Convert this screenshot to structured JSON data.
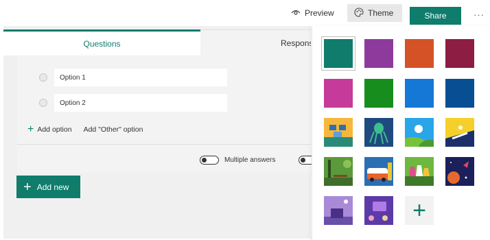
{
  "topbar": {
    "preview_label": "Preview",
    "theme_label": "Theme",
    "share_label": "Share",
    "more_label": "···"
  },
  "tabs": {
    "questions_label": "Questions",
    "responses_label": "Responses"
  },
  "question": {
    "options": [
      "Option 1",
      "Option 2"
    ],
    "add_option_label": "Add option",
    "add_other_label": "Add \"Other\" option",
    "multiple_answers_label": "Multiple answers"
  },
  "add_new_label": "Add new",
  "themes": {
    "colors": [
      "#0f7c6c",
      "#8e3a9d",
      "#d55226",
      "#8d1d42",
      "#c63b9a",
      "#178d1e",
      "#1577d6",
      "#074e92"
    ],
    "image_themes": [
      "beach-umbrellas",
      "octopus",
      "sun-hills",
      "snowboarder",
      "forest-bench",
      "bus",
      "lab-flasks",
      "space-planet",
      "night-house",
      "chat-hands"
    ],
    "custom_label": "+"
  }
}
